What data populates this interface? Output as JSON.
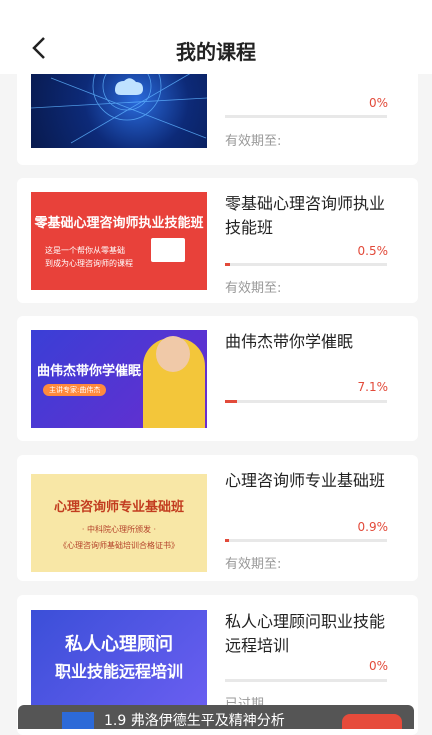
{
  "header": {
    "title": "我的课程"
  },
  "courses": [
    {
      "title": "",
      "progress": "0%",
      "expire": "有效期至:"
    },
    {
      "title": "零基础心理咨询师执业技能班",
      "progress": "0.5%",
      "expire": "有效期至:",
      "thumb": {
        "banner": "零基础心理咨询师执业技能班",
        "line1": "这是一个帮你从零基础",
        "line2": "到成为心理咨询师的课程"
      }
    },
    {
      "title": "曲伟杰带你学催眠",
      "progress": "7.1%",
      "expire": "",
      "thumb": {
        "banner": "曲伟杰带你学催眠",
        "sub": "主讲专家:曲伟杰"
      }
    },
    {
      "title": "心理咨询师专业基础班",
      "progress": "0.9%",
      "expire": "有效期至:",
      "thumb": {
        "banner": "心理咨询师专业基础班",
        "line1": "· 中科院心理所颁发 ·",
        "line2": "《心理咨询师基础培训合格证书》"
      }
    },
    {
      "title": "私人心理顾问职业技能远程培训",
      "progress": "0%",
      "expire": "已过期",
      "thumb": {
        "line1": "私人心理顾问",
        "line2": "职业技能远程培训"
      }
    }
  ],
  "bottom_banner": {
    "text": "1.9 弗洛伊德生平及精神分析"
  },
  "colors": {
    "accent": "#e24a3a",
    "card": "#ffffff",
    "background": "#f5f5f5"
  }
}
